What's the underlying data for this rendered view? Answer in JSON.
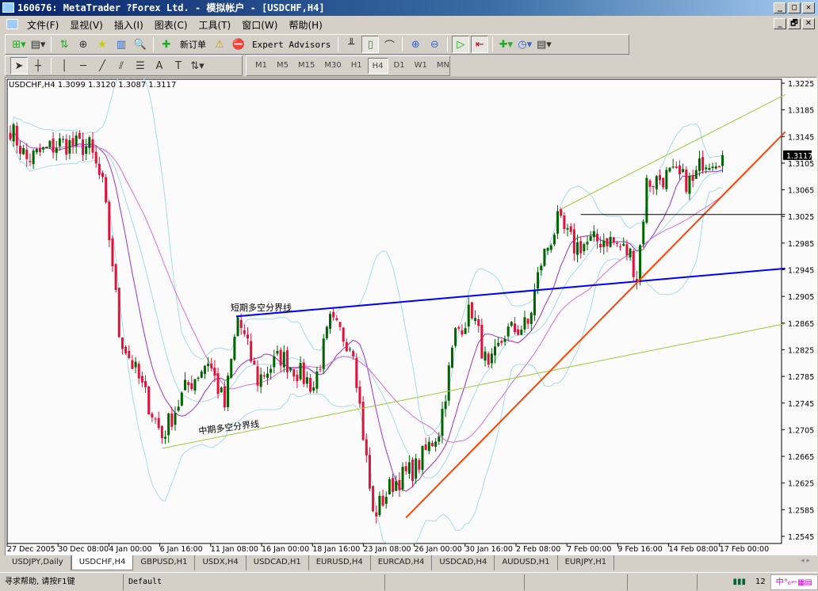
{
  "window": {
    "title": "160676: MetaTrader ?Forex Ltd. - 模拟帐户 - [USDCHF,H4]",
    "min": "_",
    "max": "□",
    "close": "✕",
    "restore": "🗗"
  },
  "menu": [
    "文件(F)",
    "显视(V)",
    "插入(I)",
    "图表(C)",
    "工具(T)",
    "窗口(W)",
    "帮助(H)"
  ],
  "toolbar": {
    "new_order": "新订单",
    "expert_advisors": "Expert Advisors"
  },
  "timeframes": [
    "M1",
    "M5",
    "M15",
    "M30",
    "H1",
    "H4",
    "D1",
    "W1",
    "MN"
  ],
  "active_timeframe": "H4",
  "chart": {
    "info": "USDCHF,H4  1.3099 1.3120 1.3087 1.3117",
    "current_price": "1.3117",
    "price_ticks": [
      "1.3225",
      "1.3185",
      "1.3145",
      "1.3105",
      "1.3065",
      "1.3025",
      "1.2985",
      "1.2945",
      "1.2905",
      "1.2865",
      "1.2825",
      "1.2785",
      "1.2745",
      "1.2705",
      "1.2665",
      "1.2625",
      "1.2585",
      "1.2545"
    ],
    "date_ticks": [
      "27 Dec 2005",
      "30 Dec 08:00",
      "4 Jan 00:00",
      "6 Jan 16:00",
      "11 Jan 08:00",
      "16 Jan 00:00",
      "18 Jan 16:00",
      "23 Jan 08:00",
      "26 Jan 00:00",
      "30 Jan 16:00",
      "2 Feb 08:00",
      "7 Feb 00:00",
      "9 Feb 16:00",
      "14 Feb 08:00",
      "17 Feb 00:00"
    ],
    "short_term_label": "短期多空分界线",
    "mid_term_label": "中期多空分界线",
    "colors": {
      "bull": "#006400",
      "bear": "#dc143c",
      "bands": "#a8dce6",
      "ma_fast": "#9932cc",
      "ma_slow": "#da70d6",
      "blue_line": "#0000ff",
      "green_line": "#9acd32",
      "orange_line": "#ff4500"
    }
  },
  "chart_data": {
    "type": "candlestick",
    "symbol": "USDCHF",
    "timeframe": "H4",
    "ylim": [
      1.2545,
      1.3225
    ],
    "price_path": [
      [
        0,
        1.3158
      ],
      [
        5,
        1.311
      ],
      [
        15,
        1.3135
      ],
      [
        24,
        1.3129
      ],
      [
        28,
        1.307
      ],
      [
        31,
        1.2956
      ],
      [
        33,
        1.285
      ],
      [
        39,
        1.278
      ],
      [
        46,
        1.2695
      ],
      [
        53,
        1.2765
      ],
      [
        60,
        1.281
      ],
      [
        65,
        1.274
      ],
      [
        69,
        1.2873
      ],
      [
        75,
        1.278
      ],
      [
        82,
        1.2815
      ],
      [
        92,
        1.277
      ],
      [
        97,
        1.2865
      ],
      [
        104,
        1.283
      ],
      [
        106,
        1.274
      ],
      [
        110,
        1.2576
      ],
      [
        116,
        1.2625
      ],
      [
        123,
        1.2648
      ],
      [
        130,
        1.2705
      ],
      [
        135,
        1.285
      ],
      [
        140,
        1.2885
      ],
      [
        145,
        1.279
      ],
      [
        150,
        1.285
      ],
      [
        157,
        1.2862
      ],
      [
        161,
        1.2957
      ],
      [
        166,
        1.3016
      ],
      [
        171,
        1.298
      ],
      [
        181,
        1.2992
      ],
      [
        188,
        1.2968
      ],
      [
        190,
        1.2933
      ],
      [
        193,
        1.3075
      ],
      [
        200,
        1.3087
      ],
      [
        207,
        1.3075
      ],
      [
        210,
        1.311
      ],
      [
        216,
        1.3117
      ]
    ],
    "trendlines": [
      {
        "name": "short-term",
        "from": [
          68.5,
          1.2875
        ],
        "to": [
          235,
          1.2947
        ],
        "color": "#0000ff"
      },
      {
        "name": "mid-term",
        "from": [
          46,
          1.2677
        ],
        "to": [
          235,
          1.2864
        ],
        "color": "#9acd32"
      },
      {
        "name": "channel-top",
        "from": [
          167,
          1.3036
        ],
        "to": [
          235,
          1.3208
        ],
        "color": "#9acd32"
      },
      {
        "name": "support",
        "from": [
          120,
          1.2573
        ],
        "to": [
          235,
          1.3152
        ],
        "color": "#ff4500"
      },
      {
        "name": "resistance",
        "from": [
          173,
          1.3028
        ],
        "to": [
          235,
          1.3028
        ],
        "color": "#000000"
      }
    ]
  },
  "tabs": [
    "USDJPY,Daily",
    "USDCHF,H4",
    "GBPUSD,H1",
    "USDX,H4",
    "USDCAD,H1",
    "EURUSD,H4",
    "EURCAD,H4",
    "USDCAD,H4",
    "AUDUSD,H1",
    "EURJPY,H1"
  ],
  "active_tab": "USDCHF,H4",
  "status": {
    "help": "寻求帮助, 请按F1键",
    "profile": "Default",
    "traffic": "12"
  }
}
